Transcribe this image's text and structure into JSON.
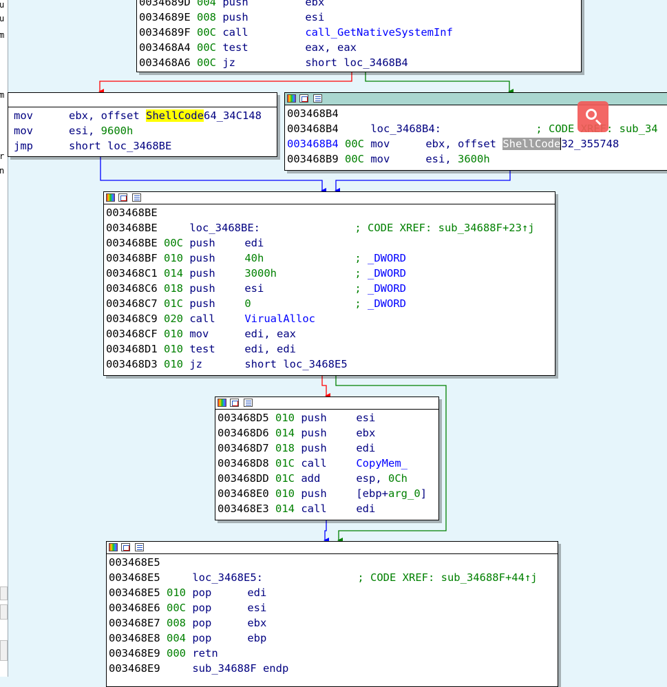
{
  "left_strip": {
    "fragments": [
      "u",
      "u",
      "m",
      "m",
      "r",
      "n"
    ]
  },
  "colors": {
    "background": "#e6f5fb",
    "edge_true": "#008000",
    "edge_false": "#ff0000",
    "edge_jump": "#0000ff",
    "teal_header": "#aad7d0",
    "search_accent": "#f25b59"
  },
  "blocks": {
    "top": {
      "lines": [
        {
          "addr": "0034689D",
          "sp": "004",
          "mn": "push",
          "op": "ebx"
        },
        {
          "addr": "0034689E",
          "sp": "008",
          "mn": "push",
          "op": "esi"
        },
        {
          "addr": "0034689F",
          "sp": "00C",
          "mn": "call",
          "op": "call_GetNativeSystemInf"
        },
        {
          "addr": "003468A4",
          "sp": "00C",
          "mn": "test",
          "op": "eax, eax"
        },
        {
          "addr": "003468A6",
          "sp": "00C",
          "mn": "jz",
          "op": "short loc_3468B4"
        }
      ]
    },
    "left64": {
      "l1": {
        "mn": "mov",
        "pre": "ebx, offset ",
        "hl": "ShellCode",
        "post": "64_34C148"
      },
      "l2": {
        "mn": "mov",
        "op": "esi, ",
        "num": "9600h"
      },
      "l3": {
        "mn": "jmp",
        "op": "short loc_3468BE"
      }
    },
    "right32": {
      "addr1": "003468B4",
      "label_addr": "003468B4",
      "label": "loc_3468B4:",
      "xref": "; CODE XREF: sub_34",
      "l1": {
        "addr": "003468B4",
        "sp": "00C",
        "mn": "mov",
        "pre": "ebx, offset ",
        "hl": "ShellCode",
        "post": "32_355748"
      },
      "l2": {
        "addr": "003468B9",
        "sp": "00C",
        "mn": "mov",
        "op": "esi, ",
        "num": "3600h"
      }
    },
    "alloc": {
      "addr1": "003468BE",
      "label_addr": "003468BE",
      "label": "loc_3468BE:",
      "xref": "; CODE XREF: sub_34688F+23↑j",
      "lines": [
        {
          "addr": "003468BE",
          "sp": "00C",
          "mn": "push",
          "op": "edi",
          "cmt": ""
        },
        {
          "addr": "003468BF",
          "sp": "010",
          "mn": "push",
          "op": "40h",
          "cmt": "; ",
          "cmt2": "_DWORD"
        },
        {
          "addr": "003468C1",
          "sp": "014",
          "mn": "push",
          "op": "3000h",
          "cmt": "; ",
          "cmt2": "_DWORD"
        },
        {
          "addr": "003468C6",
          "sp": "018",
          "mn": "push",
          "op": "esi",
          "cmt": "; ",
          "cmt2": "_DWORD"
        },
        {
          "addr": "003468C7",
          "sp": "01C",
          "mn": "push",
          "op": "0",
          "cmt": "; ",
          "cmt2": "_DWORD"
        },
        {
          "addr": "003468C9",
          "sp": "020",
          "mn": "call",
          "op": "VirualAlloc",
          "cmt": ""
        },
        {
          "addr": "003468CF",
          "sp": "010",
          "mn": "mov",
          "op": "edi, eax",
          "cmt": ""
        },
        {
          "addr": "003468D1",
          "sp": "010",
          "mn": "test",
          "op": "edi, edi",
          "cmt": ""
        },
        {
          "addr": "003468D3",
          "sp": "010",
          "mn": "jz",
          "op": "short loc_3468E5",
          "cmt": ""
        }
      ]
    },
    "copy": {
      "lines": [
        {
          "addr": "003468D5",
          "sp": "010",
          "mn": "push",
          "op": "esi"
        },
        {
          "addr": "003468D6",
          "sp": "014",
          "mn": "push",
          "op": "ebx"
        },
        {
          "addr": "003468D7",
          "sp": "018",
          "mn": "push",
          "op": "edi"
        },
        {
          "addr": "003468D8",
          "sp": "01C",
          "mn": "call",
          "op": "CopyMem_"
        },
        {
          "addr": "003468DD",
          "sp": "01C",
          "mn": "add",
          "op": "esp, ",
          "num": "0Ch"
        },
        {
          "addr": "003468E0",
          "sp": "010",
          "mn": "push",
          "op": "[ebp+",
          "num": "arg_0",
          "tail": "]"
        },
        {
          "addr": "003468E3",
          "sp": "014",
          "mn": "call",
          "op": "edi"
        }
      ]
    },
    "end": {
      "addr1": "003468E5",
      "label_addr": "003468E5",
      "label": "loc_3468E5:",
      "xref": "; CODE XREF: sub_34688F+44↑j",
      "lines": [
        {
          "addr": "003468E5",
          "sp": "010",
          "mn": "pop",
          "op": "edi"
        },
        {
          "addr": "003468E6",
          "sp": "00C",
          "mn": "pop",
          "op": "esi"
        },
        {
          "addr": "003468E7",
          "sp": "008",
          "mn": "pop",
          "op": "ebx"
        },
        {
          "addr": "003468E8",
          "sp": "004",
          "mn": "pop",
          "op": "ebp"
        },
        {
          "addr": "003468E9",
          "sp": "000",
          "mn": "retn",
          "op": ""
        }
      ],
      "endp_addr": "003468E9",
      "endp": "sub_34688F endp"
    }
  }
}
